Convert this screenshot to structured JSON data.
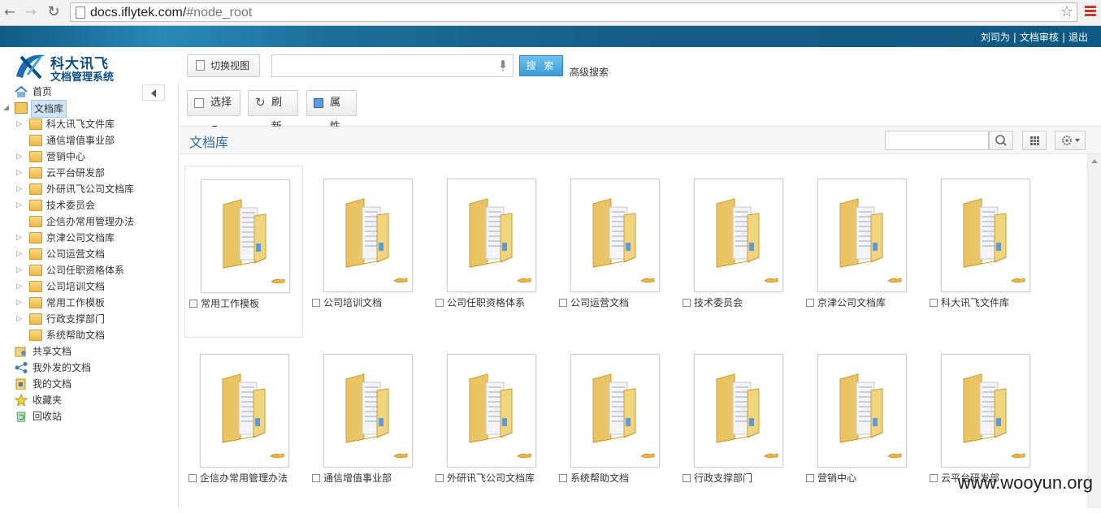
{
  "browser": {
    "url_domain": "docs.iflytek.com/",
    "url_hash": "#node_root"
  },
  "banner": {
    "user": "刘司为",
    "review": "文档审核",
    "logout": "退出",
    "separator": "|"
  },
  "logo": {
    "line1": "科大讯飞",
    "line2": "文档管理系统"
  },
  "header": {
    "switch_view": "切换视图",
    "search_button": "搜 索",
    "advanced_search": "高级搜索"
  },
  "sidebar": {
    "home": "首页",
    "library": "文档库",
    "folders": [
      "科大讯飞文件库",
      "通信增值事业部",
      "营销中心",
      "云平台研发部",
      "外研讯飞公司文档库",
      "技术委员会",
      "企信办常用管理办法",
      "京津公司文档库",
      "公司运营文档",
      "公司任职资格体系",
      "公司培训文档",
      "常用工作模板",
      "行政支撑部门",
      "系统帮助文档"
    ],
    "shared": "共享文档",
    "sent": "我外发的文档",
    "mine": "我的文档",
    "favorites": "收藏夹",
    "recycle": "回收站"
  },
  "toolbar": {
    "select": "选择",
    "refresh": "刷新",
    "properties": "属性"
  },
  "subhead": {
    "title": "文档库"
  },
  "tiles_row1": [
    "常用工作模板",
    "公司培训文档",
    "公司任职资格体系",
    "公司运营文档",
    "技术委员会",
    "京津公司文档库",
    "科大讯飞文件库"
  ],
  "tiles_row2": [
    "企信办常用管理办法",
    "通信增值事业部",
    "外研讯飞公司文档库",
    "系统帮助文档",
    "行政支撑部门",
    "营销中心",
    "云平台研发部"
  ],
  "watermark": "www.wooyun.org",
  "colors": {
    "banner": "#145d86",
    "accent": "#2d6ca2",
    "search_button": "#3a9ad6"
  }
}
